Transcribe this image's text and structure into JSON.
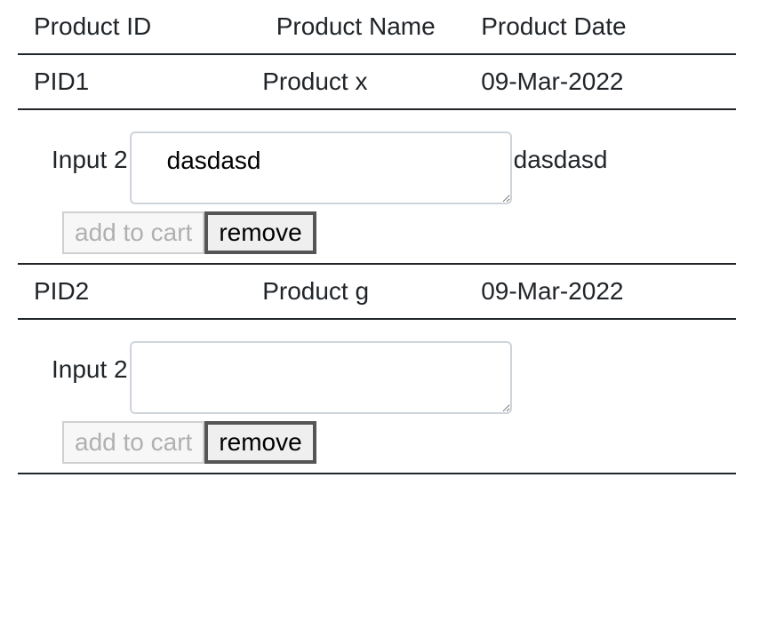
{
  "table": {
    "headers": {
      "id": "Product ID",
      "name": "Product Name",
      "date": "Product Date"
    },
    "rows": [
      {
        "id": "PID1",
        "name": "Product x",
        "date": "09-Mar-2022",
        "input_label": "Input 2",
        "input_value": "dasdasd",
        "echo": "dasdasd",
        "add_label": "add to cart",
        "add_disabled": true,
        "remove_label": "remove"
      },
      {
        "id": "PID2",
        "name": "Product g",
        "date": "09-Mar-2022",
        "input_label": "Input 2",
        "input_value": "",
        "echo": "",
        "add_label": "add to cart",
        "add_disabled": true,
        "remove_label": "remove"
      }
    ]
  }
}
